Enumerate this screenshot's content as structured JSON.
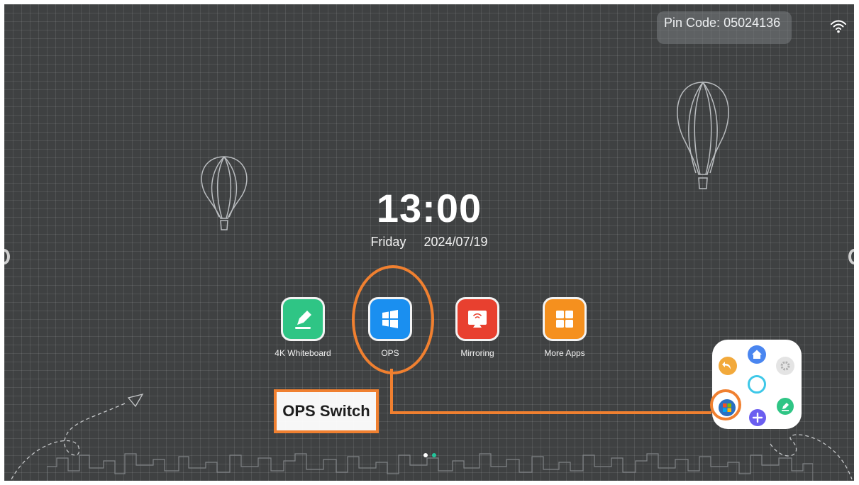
{
  "status_bar": {
    "pin_code_label": "Pin Code:",
    "pin_code_value": "05024136",
    "wifi_icon": "wifi-icon"
  },
  "clock": {
    "time": "13:00",
    "weekday": "Friday",
    "date": "2024/07/19"
  },
  "apps": [
    {
      "label": "4K Whiteboard",
      "icon": "pencil-icon",
      "color": "#2fc585"
    },
    {
      "label": "OPS",
      "icon": "windows-icon",
      "color": "#1a8ff0"
    },
    {
      "label": "Mirroring",
      "icon": "screen-cast-icon",
      "color": "#e8402f"
    },
    {
      "label": "More Apps",
      "icon": "grid-icon",
      "color": "#f5901e"
    }
  ],
  "callout": {
    "label": "OPS Switch",
    "accent": "#f08030"
  },
  "floating_menu": {
    "items": [
      "back-icon",
      "home-icon",
      "settings-icon",
      "center-circle-icon",
      "windows-icon",
      "add-icon",
      "annotate-icon"
    ]
  },
  "pagination": {
    "active_color": "#ffffff",
    "inactive_color": "#22c59a"
  }
}
